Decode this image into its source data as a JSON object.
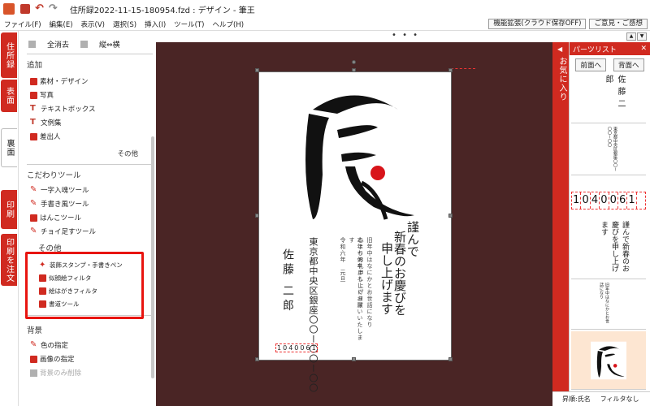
{
  "titlebar": {
    "title": "住所録2022-11-15-180954.fzd : デザイン - 筆王"
  },
  "menu": {
    "items": [
      "ファイル(F)",
      "編集(E)",
      "表示(V)",
      "選択(S)",
      "挿入(I)",
      "ツール(T)",
      "ヘルプ(H)"
    ],
    "right_buttons": [
      "機能拡張(クラウド保存OFF)",
      "ご意見・ご感想"
    ]
  },
  "vtabs": [
    "住所録",
    "表面",
    "裏面",
    "印刷",
    "印刷を注文"
  ],
  "leftpanel": {
    "top_actions": [
      "全消去",
      "縦⇔横"
    ],
    "add_title": "追加",
    "add_items": [
      "素材・デザイン",
      "写真",
      "テキストボックス",
      "文例集",
      "差出人"
    ],
    "add_more": "その他",
    "tools_title": "こだわりツール",
    "tools_items": [
      "一字入魂ツール",
      "手書き風ツール",
      "はんこツール",
      "チョイ足すツール"
    ],
    "tools_more_title": "その他",
    "highlight_items": [
      "装飾スタンプ・手書きペン",
      "似顔絵フィルタ",
      "絵はがきフィルタ",
      "書道ツール"
    ],
    "bg_title": "背景",
    "bg_items": [
      "色の指定",
      "画像の指定",
      "背景のみ削除"
    ]
  },
  "canvas": {
    "dots": "• • •",
    "greeting_cols": [
      "謹んで",
      "新春のお慶びを",
      "申し上げます"
    ],
    "small_cols": [
      "旧年中はなにかとお世話になり",
      "心よりお礼申し上げます",
      "本年も何卒よろしくお願いいたします",
      "令和六年　元旦"
    ],
    "address": "東京都中央区銀座〇〇ー〇〇ー〇〇",
    "sender": "佐藤 二郎",
    "postal": [
      "1",
      "0",
      "4",
      "0",
      "0",
      "6",
      "1"
    ]
  },
  "parts": {
    "header": "パーツリスト",
    "close": "✕",
    "buttons": [
      "前面へ",
      "背面へ"
    ],
    "fav_label": "お気に入り",
    "fav_arrow": "◀",
    "sender_thumb": "佐藤二郎",
    "postal_thumb": [
      "1",
      "0",
      "4",
      "0",
      "0",
      "6",
      "1"
    ],
    "greet_thumb": "謹んで新春のお慶びを申し上げます"
  },
  "status": {
    "left": "昇順:氏名",
    "right": "フィルタなし"
  },
  "colors": {
    "accent": "#d02a20",
    "canvas_bg": "#4a2525",
    "highlight": "#e8140f"
  }
}
